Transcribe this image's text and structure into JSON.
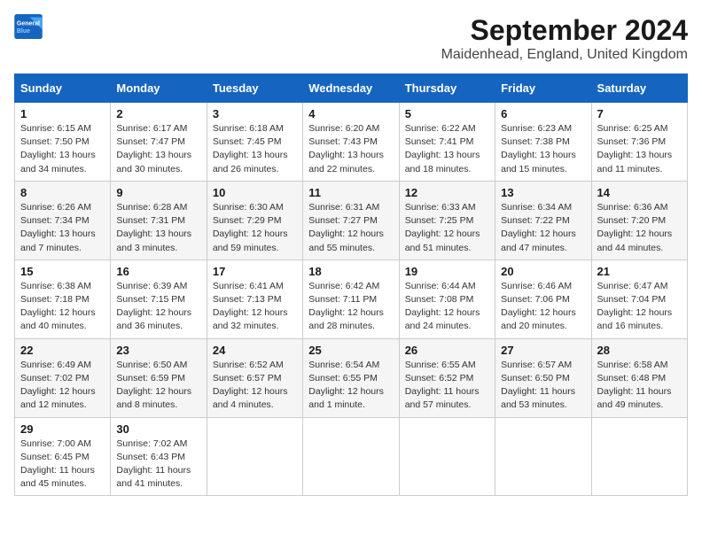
{
  "header": {
    "logo_line1": "General",
    "logo_line2": "Blue",
    "month": "September 2024",
    "location": "Maidenhead, England, United Kingdom"
  },
  "weekdays": [
    "Sunday",
    "Monday",
    "Tuesday",
    "Wednesday",
    "Thursday",
    "Friday",
    "Saturday"
  ],
  "weeks": [
    [
      {
        "day": "1",
        "info": "Sunrise: 6:15 AM\nSunset: 7:50 PM\nDaylight: 13 hours\nand 34 minutes."
      },
      {
        "day": "2",
        "info": "Sunrise: 6:17 AM\nSunset: 7:47 PM\nDaylight: 13 hours\nand 30 minutes."
      },
      {
        "day": "3",
        "info": "Sunrise: 6:18 AM\nSunset: 7:45 PM\nDaylight: 13 hours\nand 26 minutes."
      },
      {
        "day": "4",
        "info": "Sunrise: 6:20 AM\nSunset: 7:43 PM\nDaylight: 13 hours\nand 22 minutes."
      },
      {
        "day": "5",
        "info": "Sunrise: 6:22 AM\nSunset: 7:41 PM\nDaylight: 13 hours\nand 18 minutes."
      },
      {
        "day": "6",
        "info": "Sunrise: 6:23 AM\nSunset: 7:38 PM\nDaylight: 13 hours\nand 15 minutes."
      },
      {
        "day": "7",
        "info": "Sunrise: 6:25 AM\nSunset: 7:36 PM\nDaylight: 13 hours\nand 11 minutes."
      }
    ],
    [
      {
        "day": "8",
        "info": "Sunrise: 6:26 AM\nSunset: 7:34 PM\nDaylight: 13 hours\nand 7 minutes."
      },
      {
        "day": "9",
        "info": "Sunrise: 6:28 AM\nSunset: 7:31 PM\nDaylight: 13 hours\nand 3 minutes."
      },
      {
        "day": "10",
        "info": "Sunrise: 6:30 AM\nSunset: 7:29 PM\nDaylight: 12 hours\nand 59 minutes."
      },
      {
        "day": "11",
        "info": "Sunrise: 6:31 AM\nSunset: 7:27 PM\nDaylight: 12 hours\nand 55 minutes."
      },
      {
        "day": "12",
        "info": "Sunrise: 6:33 AM\nSunset: 7:25 PM\nDaylight: 12 hours\nand 51 minutes."
      },
      {
        "day": "13",
        "info": "Sunrise: 6:34 AM\nSunset: 7:22 PM\nDaylight: 12 hours\nand 47 minutes."
      },
      {
        "day": "14",
        "info": "Sunrise: 6:36 AM\nSunset: 7:20 PM\nDaylight: 12 hours\nand 44 minutes."
      }
    ],
    [
      {
        "day": "15",
        "info": "Sunrise: 6:38 AM\nSunset: 7:18 PM\nDaylight: 12 hours\nand 40 minutes."
      },
      {
        "day": "16",
        "info": "Sunrise: 6:39 AM\nSunset: 7:15 PM\nDaylight: 12 hours\nand 36 minutes."
      },
      {
        "day": "17",
        "info": "Sunrise: 6:41 AM\nSunset: 7:13 PM\nDaylight: 12 hours\nand 32 minutes."
      },
      {
        "day": "18",
        "info": "Sunrise: 6:42 AM\nSunset: 7:11 PM\nDaylight: 12 hours\nand 28 minutes."
      },
      {
        "day": "19",
        "info": "Sunrise: 6:44 AM\nSunset: 7:08 PM\nDaylight: 12 hours\nand 24 minutes."
      },
      {
        "day": "20",
        "info": "Sunrise: 6:46 AM\nSunset: 7:06 PM\nDaylight: 12 hours\nand 20 minutes."
      },
      {
        "day": "21",
        "info": "Sunrise: 6:47 AM\nSunset: 7:04 PM\nDaylight: 12 hours\nand 16 minutes."
      }
    ],
    [
      {
        "day": "22",
        "info": "Sunrise: 6:49 AM\nSunset: 7:02 PM\nDaylight: 12 hours\nand 12 minutes."
      },
      {
        "day": "23",
        "info": "Sunrise: 6:50 AM\nSunset: 6:59 PM\nDaylight: 12 hours\nand 8 minutes."
      },
      {
        "day": "24",
        "info": "Sunrise: 6:52 AM\nSunset: 6:57 PM\nDaylight: 12 hours\nand 4 minutes."
      },
      {
        "day": "25",
        "info": "Sunrise: 6:54 AM\nSunset: 6:55 PM\nDaylight: 12 hours\nand 1 minute."
      },
      {
        "day": "26",
        "info": "Sunrise: 6:55 AM\nSunset: 6:52 PM\nDaylight: 11 hours\nand 57 minutes."
      },
      {
        "day": "27",
        "info": "Sunrise: 6:57 AM\nSunset: 6:50 PM\nDaylight: 11 hours\nand 53 minutes."
      },
      {
        "day": "28",
        "info": "Sunrise: 6:58 AM\nSunset: 6:48 PM\nDaylight: 11 hours\nand 49 minutes."
      }
    ],
    [
      {
        "day": "29",
        "info": "Sunrise: 7:00 AM\nSunset: 6:45 PM\nDaylight: 11 hours\nand 45 minutes."
      },
      {
        "day": "30",
        "info": "Sunrise: 7:02 AM\nSunset: 6:43 PM\nDaylight: 11 hours\nand 41 minutes."
      },
      null,
      null,
      null,
      null,
      null
    ]
  ]
}
